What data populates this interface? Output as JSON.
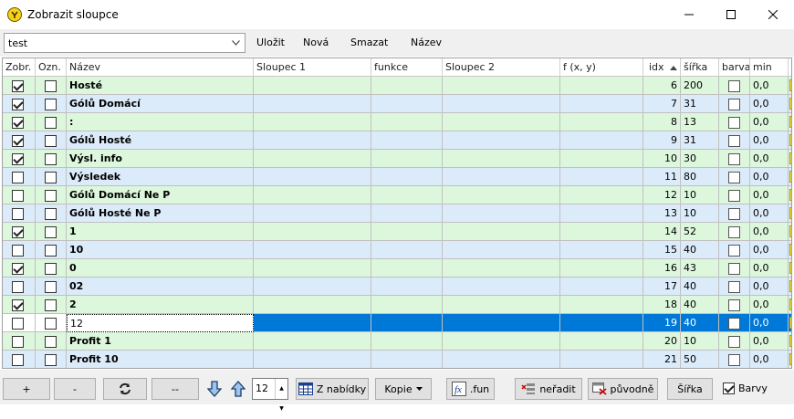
{
  "window": {
    "title": "Zobrazit sloupce"
  },
  "toolbar": {
    "combo_value": "test",
    "save_label": "Uložit",
    "new_label": "Nová",
    "delete_label": "Smazat",
    "name_label": "Název"
  },
  "columns": [
    "Zobr.",
    "Ozn.",
    "Název",
    "Sloupec 1",
    "funkce",
    "Sloupec 2",
    "f (x, y)",
    "idx",
    "šířka",
    "barva",
    "min",
    ""
  ],
  "rows": [
    {
      "zobr": true,
      "ozn": false,
      "name": "Hosté",
      "idx": "6",
      "sirka": "200",
      "min": "0,0",
      "bold": true,
      "color": "green"
    },
    {
      "zobr": true,
      "ozn": false,
      "name": "Gólů Domácí",
      "idx": "7",
      "sirka": "31",
      "min": "0,0",
      "bold": true,
      "color": "blue"
    },
    {
      "zobr": true,
      "ozn": false,
      "name": ":",
      "idx": "8",
      "sirka": "13",
      "min": "0,0",
      "bold": true,
      "color": "green"
    },
    {
      "zobr": true,
      "ozn": false,
      "name": "Gólů Hosté",
      "idx": "9",
      "sirka": "31",
      "min": "0,0",
      "bold": true,
      "color": "blue"
    },
    {
      "zobr": true,
      "ozn": false,
      "name": "Výsl. info",
      "idx": "10",
      "sirka": "30",
      "min": "0,0",
      "bold": true,
      "color": "green"
    },
    {
      "zobr": false,
      "ozn": false,
      "name": "Výsledek",
      "idx": "11",
      "sirka": "80",
      "min": "0,0",
      "bold": true,
      "color": "blue"
    },
    {
      "zobr": false,
      "ozn": false,
      "name": "Gólů Domácí Ne P",
      "idx": "12",
      "sirka": "10",
      "min": "0,0",
      "bold": true,
      "color": "green"
    },
    {
      "zobr": false,
      "ozn": false,
      "name": "Gólů Hosté Ne P",
      "idx": "13",
      "sirka": "10",
      "min": "0,0",
      "bold": true,
      "color": "blue"
    },
    {
      "zobr": true,
      "ozn": false,
      "name": "1",
      "idx": "14",
      "sirka": "52",
      "min": "0,0",
      "bold": true,
      "color": "green"
    },
    {
      "zobr": false,
      "ozn": false,
      "name": "10",
      "idx": "15",
      "sirka": "40",
      "min": "0,0",
      "bold": true,
      "color": "blue"
    },
    {
      "zobr": true,
      "ozn": false,
      "name": "0",
      "idx": "16",
      "sirka": "43",
      "min": "0,0",
      "bold": true,
      "color": "green"
    },
    {
      "zobr": false,
      "ozn": false,
      "name": "02",
      "idx": "17",
      "sirka": "40",
      "min": "0,0",
      "bold": true,
      "color": "blue"
    },
    {
      "zobr": true,
      "ozn": false,
      "name": "2",
      "idx": "18",
      "sirka": "40",
      "min": "0,0",
      "bold": true,
      "color": "green"
    },
    {
      "zobr": false,
      "ozn": false,
      "name": "12",
      "idx": "19",
      "sirka": "40",
      "min": "0,0",
      "bold": false,
      "color": "selected"
    },
    {
      "zobr": false,
      "ozn": false,
      "name": "Profit 1",
      "idx": "20",
      "sirka": "10",
      "min": "0,0",
      "bold": true,
      "color": "green"
    },
    {
      "zobr": false,
      "ozn": false,
      "name": "Profit 10",
      "idx": "21",
      "sirka": "50",
      "min": "0,0",
      "bold": true,
      "color": "blue"
    }
  ],
  "row_colors": {
    "green": "#dcf7dc",
    "blue": "#dcebfa",
    "selected": "#0078d7"
  },
  "bottom": {
    "add_label": "+",
    "remove_label": "-",
    "refresh_icon": "refresh-icon",
    "dash_label": "--",
    "spin_value": "12",
    "from_menu_label": "Z nabídky",
    "copy_label": "Kopie",
    "fun_label": ".fun",
    "unsort_label": "neřadit",
    "original_label": "původně",
    "width_label": "Šířka",
    "colors_label": "Barvy",
    "colors_checked": true
  }
}
